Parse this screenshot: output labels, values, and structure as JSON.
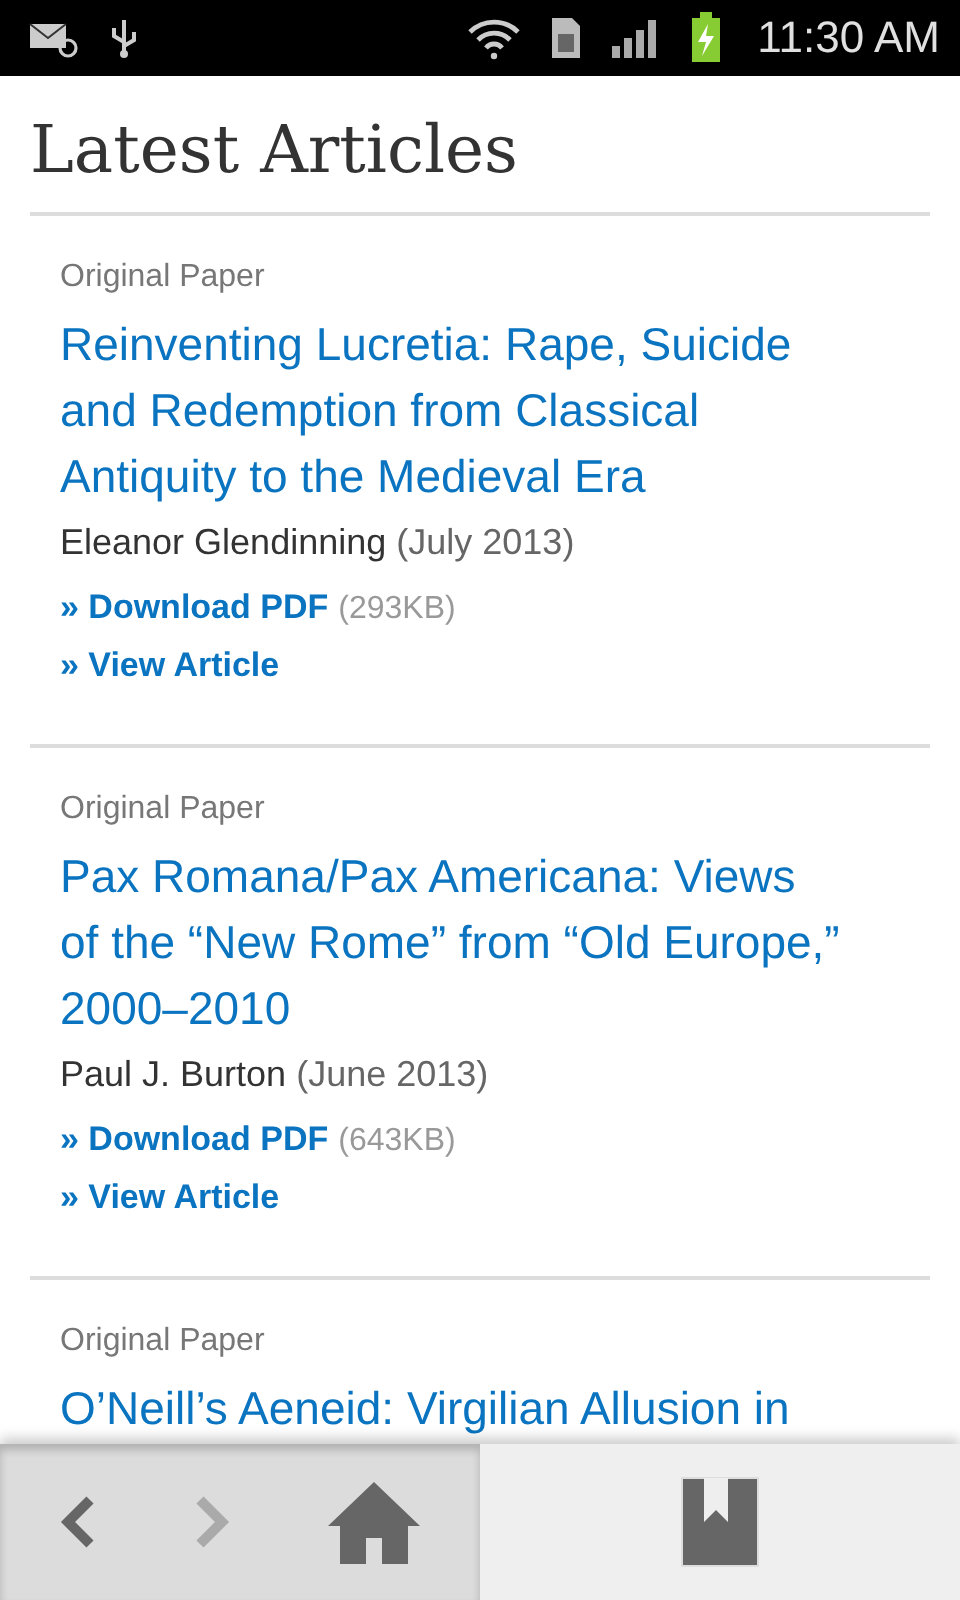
{
  "status_bar": {
    "time": "11:30 AM"
  },
  "heading": "Latest Articles",
  "articles": [
    {
      "category": "Original Paper",
      "title": "Reinventing Lucretia: Rape, Suicide and Redemption from Classical Antiquity to the Medieval Era",
      "author": "Eleanor Glendinning",
      "date": "(July 2013)",
      "links": [
        {
          "label": "» Download PDF",
          "size": "(293KB)"
        },
        {
          "label": "» View Article"
        }
      ]
    },
    {
      "category": "Original Paper",
      "title": "Pax Romana/Pax Americana: Views of the “New Rome” from “Old Europe,” 2000–2010",
      "author": "Paul J. Burton",
      "date": "(June 2013)",
      "links": [
        {
          "label": "» Download PDF",
          "size": "(643KB)"
        },
        {
          "label": "» View Article"
        }
      ]
    },
    {
      "category": "Original Paper",
      "title": "O’Neill’s Aeneid: Virgilian Allusion in"
    }
  ],
  "toolbar": {
    "back_disabled": false,
    "forward_disabled": true
  }
}
